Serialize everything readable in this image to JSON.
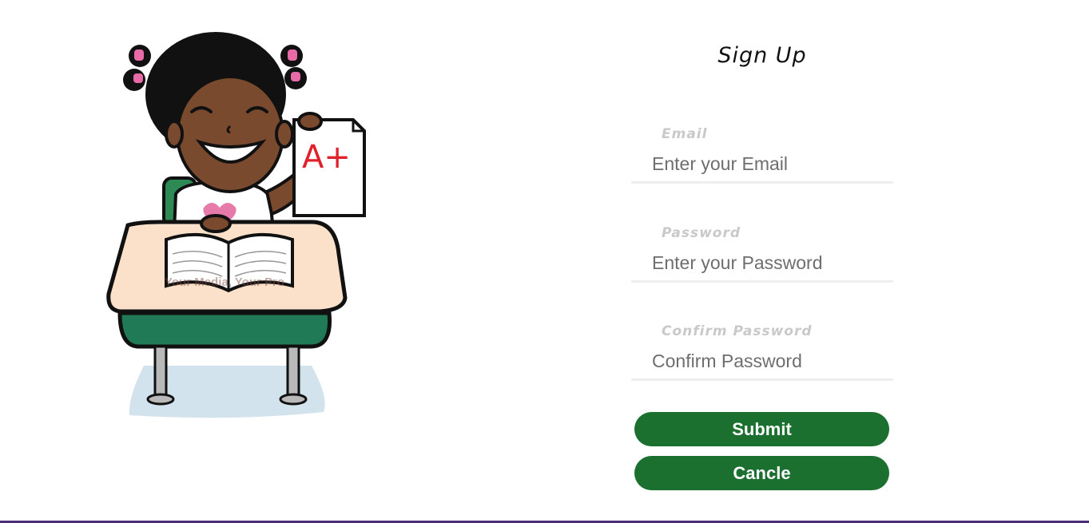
{
  "form": {
    "title": "Sign Up",
    "fields": [
      {
        "label": "Email",
        "placeholder": "Enter your Email",
        "type": "email"
      },
      {
        "label": "Password",
        "placeholder": "Enter your Password",
        "type": "password"
      },
      {
        "label": "Confirm Password",
        "placeholder": "Confirm Password",
        "type": "password"
      }
    ],
    "submit_label": "Submit",
    "cancel_label": "Cancle"
  },
  "illustration": {
    "icon": "student-at-desk-illustration",
    "paper_grade": "A+",
    "watermark_text": "Your Media, Your Pro"
  },
  "colors": {
    "button_bg": "#1b7030",
    "button_text": "#ffffff",
    "label_text": "#c9c9c9",
    "input_underline": "#eeeeee",
    "bottom_rule": "#4b2d73"
  }
}
